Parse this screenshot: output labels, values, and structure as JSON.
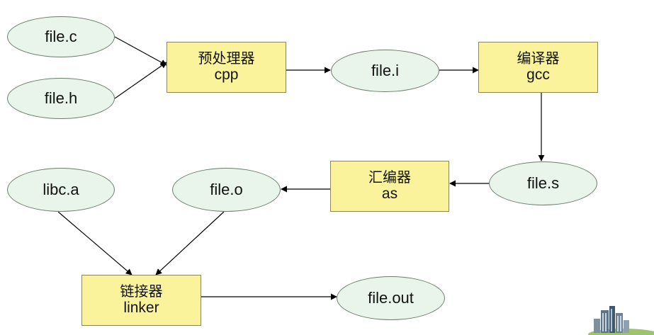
{
  "colors": {
    "oval_fill": "#e9f5ea",
    "box_fill": "#fbf39b",
    "edge": "#000000"
  },
  "nodes": {
    "file_c": {
      "label": "file.c"
    },
    "file_h": {
      "label": "file.h"
    },
    "preprocessor": {
      "label_zh": "预处理器",
      "label_en": "cpp"
    },
    "file_i": {
      "label": "file.i"
    },
    "compiler": {
      "label_zh": "编译器",
      "label_en": "gcc"
    },
    "file_s": {
      "label": "file.s"
    },
    "assembler": {
      "label_zh": "汇编器",
      "label_en": "as"
    },
    "file_o": {
      "label": "file.o"
    },
    "libc_a": {
      "label": "libc.a"
    },
    "linker": {
      "label_zh": "链接器",
      "label_en": "linker"
    },
    "file_out": {
      "label": "file.out"
    }
  },
  "edges": [
    {
      "from": "file_c",
      "to": "preprocessor"
    },
    {
      "from": "file_h",
      "to": "preprocessor"
    },
    {
      "from": "preprocessor",
      "to": "file_i"
    },
    {
      "from": "file_i",
      "to": "compiler"
    },
    {
      "from": "compiler",
      "to": "file_s"
    },
    {
      "from": "file_s",
      "to": "assembler"
    },
    {
      "from": "assembler",
      "to": "file_o"
    },
    {
      "from": "libc_a",
      "to": "linker"
    },
    {
      "from": "file_o",
      "to": "linker"
    },
    {
      "from": "linker",
      "to": "file_out"
    }
  ],
  "decoration": {
    "logo_icon": "city-buildings-icon"
  }
}
